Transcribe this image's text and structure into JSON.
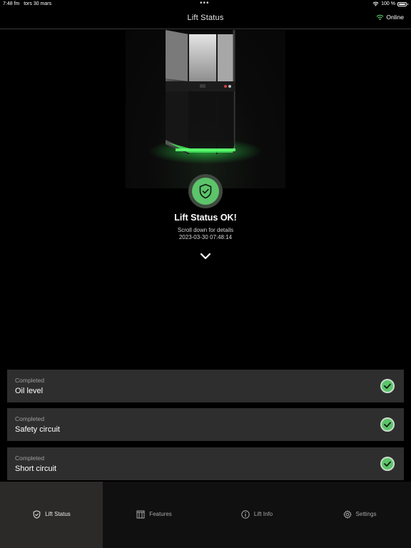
{
  "statusbar": {
    "time": "7:48 fm",
    "date": "tors 30 mars",
    "dots": "•••",
    "battery": "100 %"
  },
  "header": {
    "title": "Lift Status",
    "connection": "Online",
    "connection_color": "#5cc46a"
  },
  "status": {
    "title": "Lift Status OK!",
    "subtitle": "Scroll down for details",
    "timestamp": "2023-03-30 07:48:14",
    "icon": "shield-check-icon",
    "color": "#5cc46a"
  },
  "checks": [
    {
      "state": "Completed",
      "name": "Oil level"
    },
    {
      "state": "Completed",
      "name": "Safety circuit"
    },
    {
      "state": "Completed",
      "name": "Short circuit"
    }
  ],
  "tabs": [
    {
      "label": "Lift Status",
      "icon": "shield-icon",
      "active": true
    },
    {
      "label": "Features",
      "icon": "door-icon",
      "active": false
    },
    {
      "label": "Lift Info",
      "icon": "info-icon",
      "active": false
    },
    {
      "label": "Settings",
      "icon": "gear-icon",
      "active": false
    }
  ]
}
